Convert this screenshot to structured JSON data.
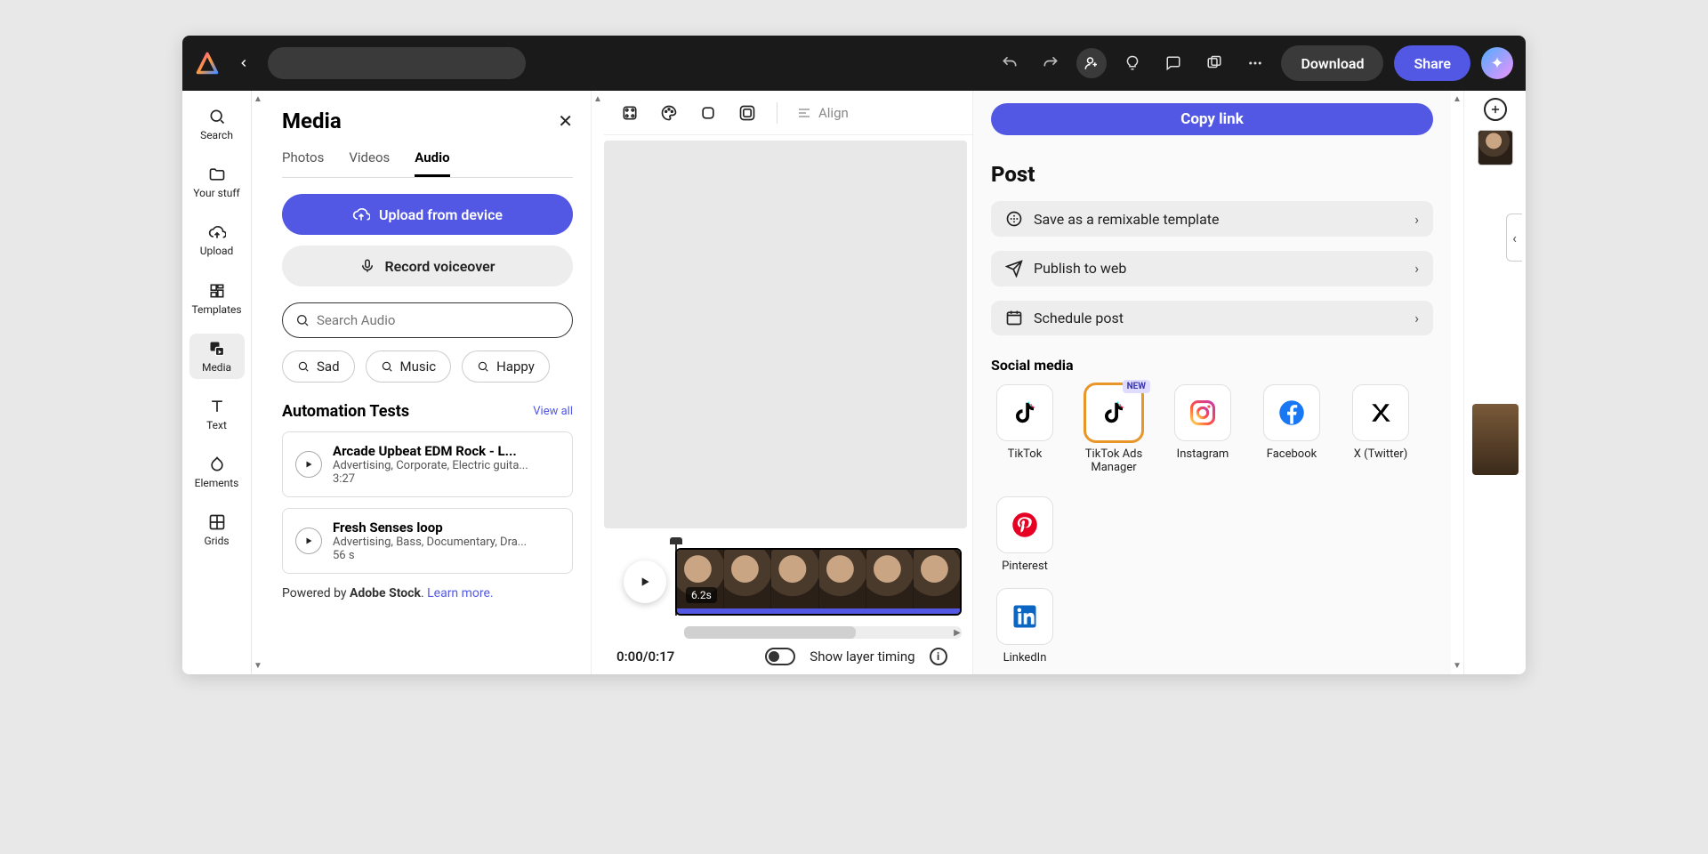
{
  "topbar": {
    "download": "Download",
    "share": "Share"
  },
  "rail": {
    "search": "Search",
    "your_stuff": "Your stuff",
    "upload": "Upload",
    "templates": "Templates",
    "media": "Media",
    "text": "Text",
    "elements": "Elements",
    "grids": "Grids"
  },
  "media": {
    "title": "Media",
    "tabs": {
      "photos": "Photos",
      "videos": "Videos",
      "audio": "Audio"
    },
    "upload_btn": "Upload from device",
    "record_btn": "Record voiceover",
    "search_placeholder": "Search Audio",
    "chips": {
      "sad": "Sad",
      "music": "Music",
      "happy": "Happy"
    },
    "section_title": "Automation Tests",
    "view_all": "View all",
    "tracks": [
      {
        "title": "Arcade Upbeat EDM Rock - L...",
        "meta": "Advertising, Corporate, Electric guita...",
        "duration": "3:27"
      },
      {
        "title": "Fresh Senses loop",
        "meta": "Advertising, Bass, Documentary, Dra...",
        "duration": "56 s"
      }
    ],
    "powered_pre": "Powered by ",
    "powered_brand": "Adobe Stock",
    "powered_post": ". ",
    "learn_more": "Learn more."
  },
  "canvas_toolbar": {
    "align": "Align"
  },
  "timeline": {
    "badge": "6.2s"
  },
  "bottom": {
    "timecode": "0:00/0:17",
    "show_layer_timing": "Show layer timing"
  },
  "share_panel": {
    "copy_link": "Copy link",
    "post_title": "Post",
    "options": {
      "remix": "Save as a remixable template",
      "publish": "Publish to web",
      "schedule": "Schedule post"
    },
    "social_title": "Social media",
    "new_badge": "NEW",
    "social": {
      "tiktok": "TikTok",
      "tiktok_ads": "TikTok Ads Manager",
      "instagram": "Instagram",
      "facebook": "Facebook",
      "x": "X (Twitter)",
      "pinterest": "Pinterest",
      "linkedin": "LinkedIn"
    }
  }
}
